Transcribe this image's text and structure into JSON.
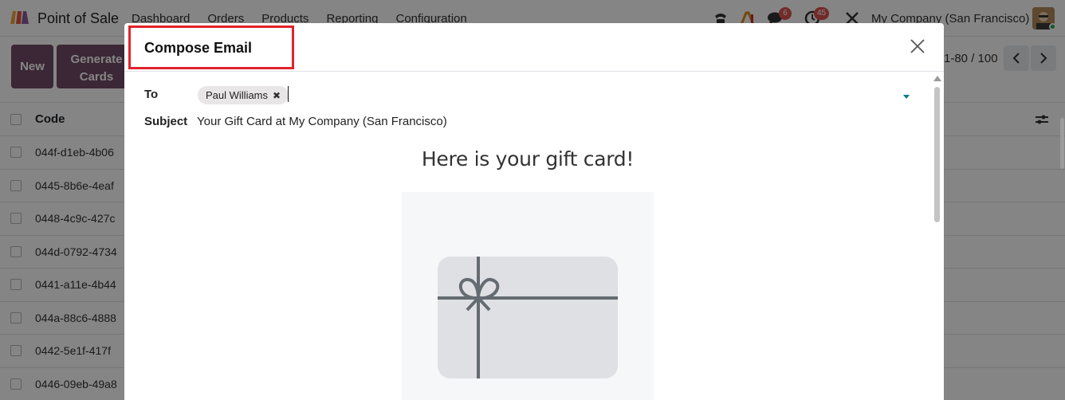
{
  "app": {
    "name": "Point of Sale",
    "menu": [
      "Dashboard",
      "Orders",
      "Products",
      "Reporting",
      "Configuration"
    ],
    "company": "My Company (San Francisco)",
    "badges": {
      "messages": "6",
      "activities": "45"
    }
  },
  "control": {
    "new_label": "New",
    "generate_label_line1": "Generate",
    "generate_label_line2": "Cards",
    "pager": "1-80 / 100"
  },
  "list": {
    "code_header": "Code",
    "rows": [
      "044f-d1eb-4b06",
      "0445-8b6e-4eaf",
      "0448-4c9c-427c",
      "044d-0792-4734",
      "0441-a11e-4b44",
      "044a-88c6-4888",
      "0442-5e1f-417f",
      "0446-09eb-49a8"
    ]
  },
  "modal": {
    "title": "Compose Email",
    "to_label": "To",
    "recipient": "Paul Williams",
    "subject_label": "Subject",
    "subject_value": "Your Gift Card at My Company (San Francisco)",
    "body_heading": "Here is your gift card!"
  },
  "colors": {
    "brand": "#714b67",
    "highlight": "#e0232b",
    "badge": "#d9534f",
    "accent": "#017e84"
  }
}
